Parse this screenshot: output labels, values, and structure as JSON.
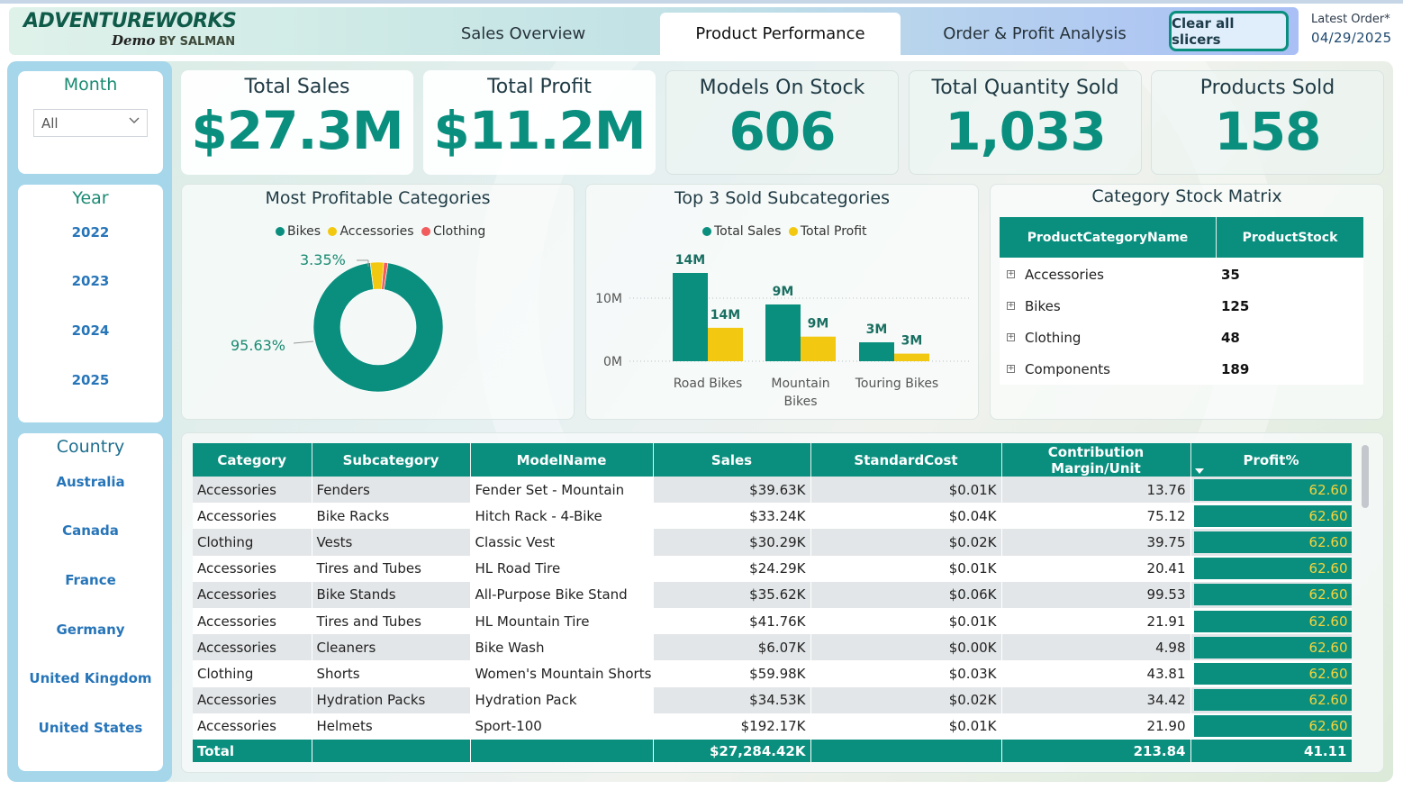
{
  "header": {
    "logo_main": "ADVENTUREWORKS",
    "logo_demo": "Demo",
    "logo_by": "BY SALMAN",
    "tabs": [
      "Sales Overview",
      "Product Performance",
      "Order & Profit Analysis"
    ],
    "active_tab": "Product Performance",
    "clear_button": "Clear all slicers",
    "latest_label": "Latest Order*",
    "latest_date": "04/29/2025"
  },
  "slicers": {
    "month": {
      "title": "Month",
      "selected": "All"
    },
    "year": {
      "title": "Year",
      "items": [
        "2022",
        "2023",
        "2024",
        "2025"
      ]
    },
    "country": {
      "title": "Country",
      "items": [
        "Australia",
        "Canada",
        "France",
        "Germany",
        "United Kingdom",
        "United States"
      ]
    }
  },
  "kpis": [
    {
      "title": "Total Sales",
      "value": "$27.3M"
    },
    {
      "title": "Total Profit",
      "value": "$11.2M"
    },
    {
      "title": "Models On Stock",
      "value": "606"
    },
    {
      "title": "Total Quantity Sold",
      "value": "1,033"
    },
    {
      "title": "Products Sold",
      "value": "158"
    }
  ],
  "colors": {
    "teal": "#0a8f7f",
    "yellow": "#f2c811",
    "red": "#f25c5c",
    "bar_text": "#f7d33a"
  },
  "chart_data": [
    {
      "type": "pie",
      "title": "Most Profitable Categories",
      "legend": [
        "Bikes",
        "Accessories",
        "Clothing"
      ],
      "values": [
        95.63,
        3.35,
        1.02
      ],
      "labels_shown": [
        "95.63%",
        "3.35%"
      ],
      "legend_position": "top-center"
    },
    {
      "type": "bar",
      "title": "Top 3 Sold Subcategories",
      "categories": [
        "Road Bikes",
        "Mountain Bikes",
        "Touring Bikes"
      ],
      "series": [
        {
          "name": "Total Sales",
          "values": [
            14,
            9,
            3
          ],
          "labels": [
            "14M",
            "9M",
            "3M"
          ]
        },
        {
          "name": "Total Profit",
          "values": [
            5.3,
            3.9,
            1.2
          ],
          "labels": [
            "14M",
            "9M",
            "3M"
          ]
        }
      ],
      "yticks": [
        "0M",
        "10M"
      ],
      "ylim": [
        0,
        16
      ],
      "grid": true,
      "legend_position": "top-center"
    }
  ],
  "matrix": {
    "title": "Category Stock Matrix",
    "headers": [
      "ProductCategoryName",
      "ProductStock"
    ],
    "rows": [
      {
        "name": "Accessories",
        "value": "35"
      },
      {
        "name": "Bikes",
        "value": "125"
      },
      {
        "name": "Clothing",
        "value": "48"
      },
      {
        "name": "Components",
        "value": "189"
      }
    ]
  },
  "table": {
    "headers": [
      "Category",
      "Subcategory",
      "ModelName",
      "Sales",
      "StandardCost",
      "Contribution Margin/Unit",
      "Profit%"
    ],
    "rows": [
      [
        "Accessories",
        "Fenders",
        "Fender Set - Mountain",
        "$39.63K",
        "$0.01K",
        "13.76",
        "62.60"
      ],
      [
        "Accessories",
        "Bike Racks",
        "Hitch Rack - 4-Bike",
        "$33.24K",
        "$0.04K",
        "75.12",
        "62.60"
      ],
      [
        "Clothing",
        "Vests",
        "Classic Vest",
        "$30.29K",
        "$0.02K",
        "39.75",
        "62.60"
      ],
      [
        "Accessories",
        "Tires and Tubes",
        "HL Road Tire",
        "$24.29K",
        "$0.01K",
        "20.41",
        "62.60"
      ],
      [
        "Accessories",
        "Bike Stands",
        "All-Purpose Bike Stand",
        "$35.62K",
        "$0.06K",
        "99.53",
        "62.60"
      ],
      [
        "Accessories",
        "Tires and Tubes",
        "HL Mountain Tire",
        "$41.76K",
        "$0.01K",
        "21.91",
        "62.60"
      ],
      [
        "Accessories",
        "Cleaners",
        "Bike Wash",
        "$6.07K",
        "$0.00K",
        "4.98",
        "62.60"
      ],
      [
        "Clothing",
        "Shorts",
        "Women's Mountain Shorts",
        "$59.98K",
        "$0.03K",
        "43.81",
        "62.60"
      ],
      [
        "Accessories",
        "Hydration Packs",
        "Hydration Pack",
        "$34.53K",
        "$0.02K",
        "34.42",
        "62.60"
      ],
      [
        "Accessories",
        "Helmets",
        "Sport-100",
        "$192.17K",
        "$0.01K",
        "21.90",
        "62.60"
      ]
    ],
    "total": [
      "Total",
      "",
      "",
      "$27,284.42K",
      "",
      "213.84",
      "41.11"
    ]
  }
}
